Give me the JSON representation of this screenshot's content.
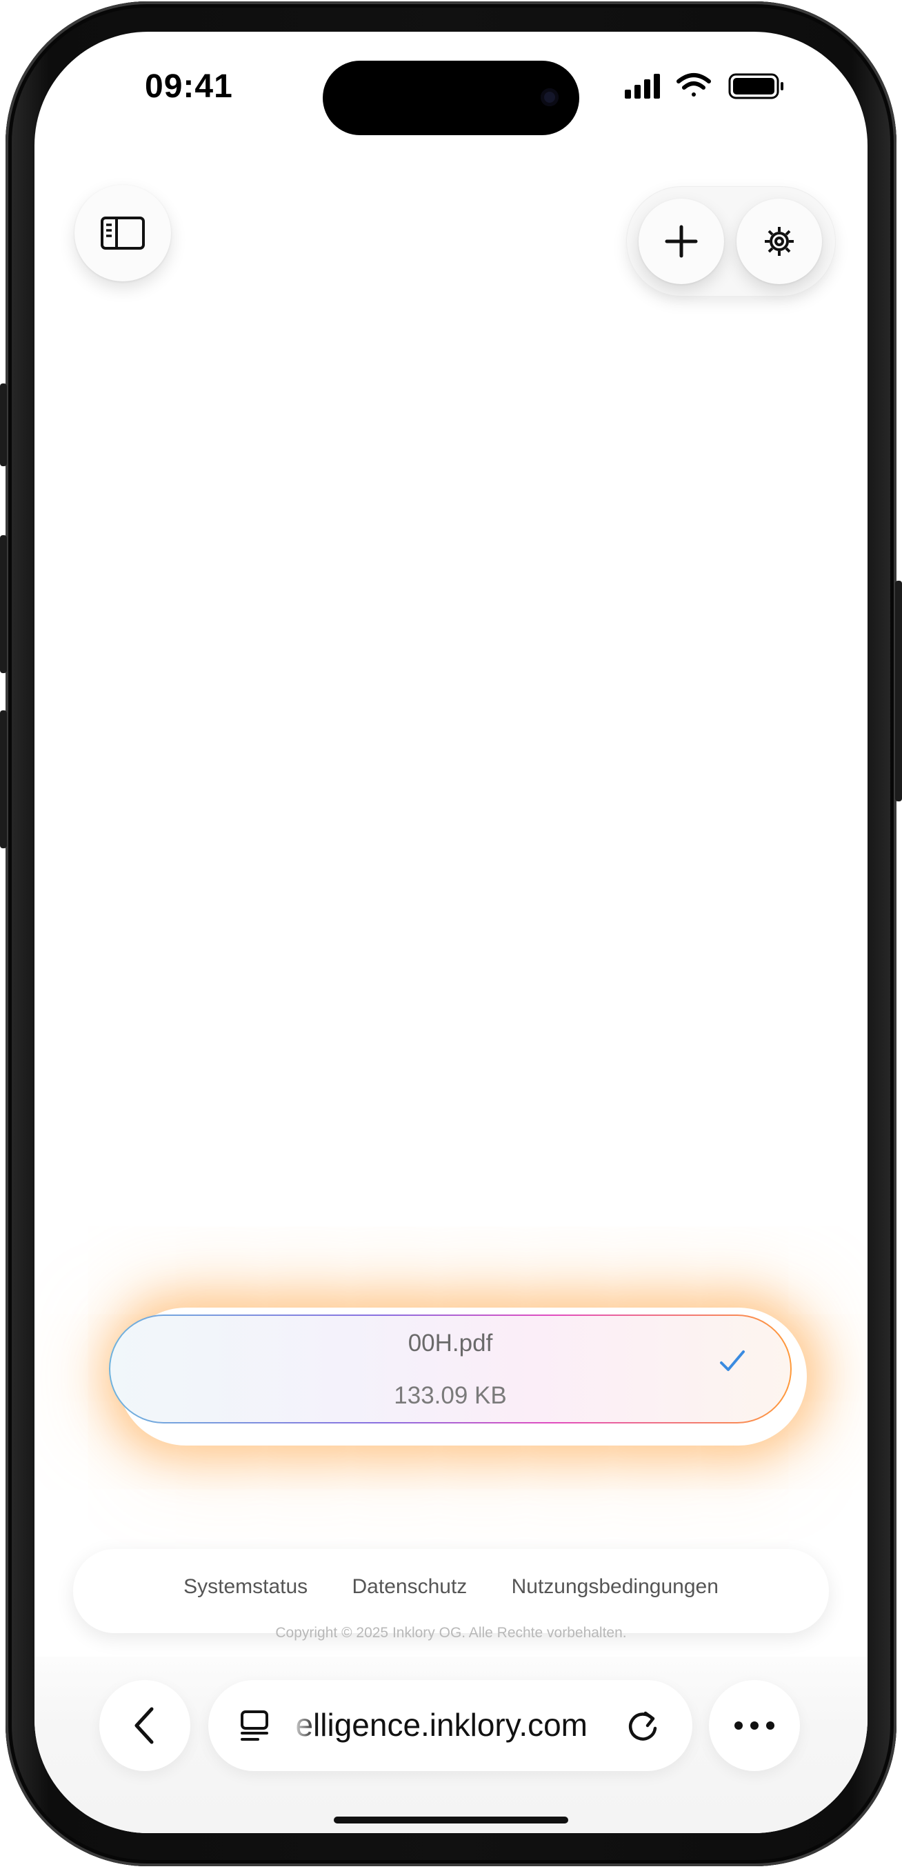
{
  "status_bar": {
    "time": "09:41"
  },
  "toolbar": {
    "sidebar_icon": "sidebar-icon",
    "add_icon": "plus-icon",
    "settings_icon": "gear-icon"
  },
  "file": {
    "name": "00H.pdf",
    "size": "133.09 KB",
    "status_icon": "checkmark-icon"
  },
  "footer": {
    "links": [
      "Systemstatus",
      "Datenschutz",
      "Nutzungsbedingungen"
    ],
    "copyright": "Copyright © 2025 Inklory OG. Alle Rechte vorbehalten."
  },
  "browser": {
    "url": "elligence.inklory.com",
    "back_icon": "chevron-left-icon",
    "tabs_icon": "tabs-icon",
    "reload_icon": "reload-icon",
    "more_icon": "ellipsis-icon"
  },
  "colors": {
    "accent_check": "#3b8be0",
    "glow": "#ff9a3a"
  }
}
